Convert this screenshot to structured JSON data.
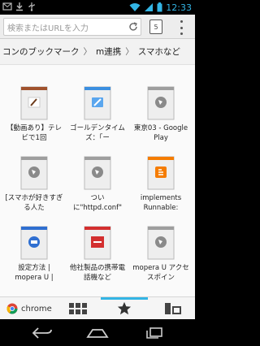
{
  "status": {
    "time": "12:33"
  },
  "toolbar": {
    "omnibox_placeholder": "検索またはURLを入力",
    "tab_count": "5"
  },
  "breadcrumb": {
    "items": [
      "コンのブックマーク",
      "m連携",
      "スマホなど"
    ]
  },
  "bookmarks": [
    {
      "label": "【動画あり】テレビで1回",
      "icon": "document-feather-icon",
      "color": "#a0522d"
    },
    {
      "label": "ゴールデンタイムズ：「ー",
      "icon": "document-blue-icon",
      "color": "#3b8fe0"
    },
    {
      "label": "東京03 - Google Play",
      "icon": "globe-page-icon",
      "color": "#9e9e9e"
    },
    {
      "label": "[スマホが好きすぎる人た",
      "icon": "globe-page-icon",
      "color": "#9e9e9e"
    },
    {
      "label": "つい に\"httpd.conf\"",
      "icon": "globe-page-icon",
      "color": "#9e9e9e"
    },
    {
      "label": "implements Runnable:",
      "icon": "blogger-page-icon",
      "color": "#f57c00"
    },
    {
      "label": "設定方法 | mopera U |",
      "icon": "docomo-globe-page-icon",
      "color": "#2f6fd1"
    },
    {
      "label": "他社製品の携帯電話機など",
      "icon": "docomo-red-page-icon",
      "color": "#d32f2f"
    },
    {
      "label": "mopera U アクセスポイン",
      "icon": "globe-page-icon",
      "color": "#9e9e9e"
    }
  ],
  "bottom": {
    "chrome_label": "chrome"
  },
  "colors": {
    "accent": "#33b5e5"
  }
}
